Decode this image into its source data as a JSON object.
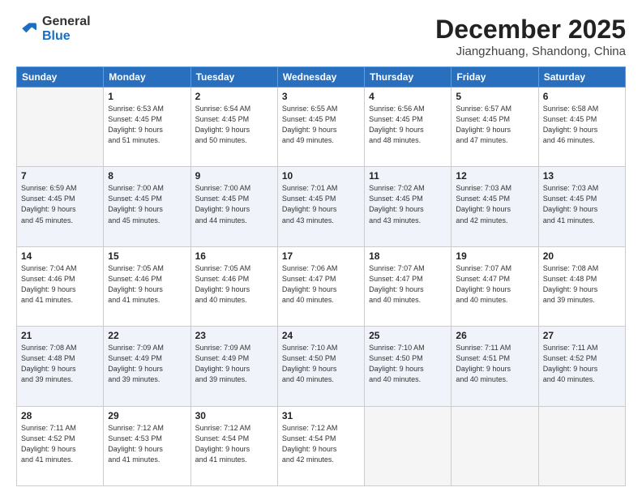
{
  "header": {
    "logo": {
      "general": "General",
      "blue": "Blue"
    },
    "title": "December 2025",
    "location": "Jiangzhuang, Shandong, China"
  },
  "weekdays": [
    "Sunday",
    "Monday",
    "Tuesday",
    "Wednesday",
    "Thursday",
    "Friday",
    "Saturday"
  ],
  "weeks": [
    [
      {
        "day": "",
        "sunrise": "",
        "sunset": "",
        "daylight": ""
      },
      {
        "day": "1",
        "sunrise": "Sunrise: 6:53 AM",
        "sunset": "Sunset: 4:45 PM",
        "daylight": "Daylight: 9 hours and 51 minutes."
      },
      {
        "day": "2",
        "sunrise": "Sunrise: 6:54 AM",
        "sunset": "Sunset: 4:45 PM",
        "daylight": "Daylight: 9 hours and 50 minutes."
      },
      {
        "day": "3",
        "sunrise": "Sunrise: 6:55 AM",
        "sunset": "Sunset: 4:45 PM",
        "daylight": "Daylight: 9 hours and 49 minutes."
      },
      {
        "day": "4",
        "sunrise": "Sunrise: 6:56 AM",
        "sunset": "Sunset: 4:45 PM",
        "daylight": "Daylight: 9 hours and 48 minutes."
      },
      {
        "day": "5",
        "sunrise": "Sunrise: 6:57 AM",
        "sunset": "Sunset: 4:45 PM",
        "daylight": "Daylight: 9 hours and 47 minutes."
      },
      {
        "day": "6",
        "sunrise": "Sunrise: 6:58 AM",
        "sunset": "Sunset: 4:45 PM",
        "daylight": "Daylight: 9 hours and 46 minutes."
      }
    ],
    [
      {
        "day": "7",
        "sunrise": "Sunrise: 6:59 AM",
        "sunset": "Sunset: 4:45 PM",
        "daylight": "Daylight: 9 hours and 45 minutes."
      },
      {
        "day": "8",
        "sunrise": "Sunrise: 7:00 AM",
        "sunset": "Sunset: 4:45 PM",
        "daylight": "Daylight: 9 hours and 45 minutes."
      },
      {
        "day": "9",
        "sunrise": "Sunrise: 7:00 AM",
        "sunset": "Sunset: 4:45 PM",
        "daylight": "Daylight: 9 hours and 44 minutes."
      },
      {
        "day": "10",
        "sunrise": "Sunrise: 7:01 AM",
        "sunset": "Sunset: 4:45 PM",
        "daylight": "Daylight: 9 hours and 43 minutes."
      },
      {
        "day": "11",
        "sunrise": "Sunrise: 7:02 AM",
        "sunset": "Sunset: 4:45 PM",
        "daylight": "Daylight: 9 hours and 43 minutes."
      },
      {
        "day": "12",
        "sunrise": "Sunrise: 7:03 AM",
        "sunset": "Sunset: 4:45 PM",
        "daylight": "Daylight: 9 hours and 42 minutes."
      },
      {
        "day": "13",
        "sunrise": "Sunrise: 7:03 AM",
        "sunset": "Sunset: 4:45 PM",
        "daylight": "Daylight: 9 hours and 41 minutes."
      }
    ],
    [
      {
        "day": "14",
        "sunrise": "Sunrise: 7:04 AM",
        "sunset": "Sunset: 4:46 PM",
        "daylight": "Daylight: 9 hours and 41 minutes."
      },
      {
        "day": "15",
        "sunrise": "Sunrise: 7:05 AM",
        "sunset": "Sunset: 4:46 PM",
        "daylight": "Daylight: 9 hours and 41 minutes."
      },
      {
        "day": "16",
        "sunrise": "Sunrise: 7:05 AM",
        "sunset": "Sunset: 4:46 PM",
        "daylight": "Daylight: 9 hours and 40 minutes."
      },
      {
        "day": "17",
        "sunrise": "Sunrise: 7:06 AM",
        "sunset": "Sunset: 4:47 PM",
        "daylight": "Daylight: 9 hours and 40 minutes."
      },
      {
        "day": "18",
        "sunrise": "Sunrise: 7:07 AM",
        "sunset": "Sunset: 4:47 PM",
        "daylight": "Daylight: 9 hours and 40 minutes."
      },
      {
        "day": "19",
        "sunrise": "Sunrise: 7:07 AM",
        "sunset": "Sunset: 4:47 PM",
        "daylight": "Daylight: 9 hours and 40 minutes."
      },
      {
        "day": "20",
        "sunrise": "Sunrise: 7:08 AM",
        "sunset": "Sunset: 4:48 PM",
        "daylight": "Daylight: 9 hours and 39 minutes."
      }
    ],
    [
      {
        "day": "21",
        "sunrise": "Sunrise: 7:08 AM",
        "sunset": "Sunset: 4:48 PM",
        "daylight": "Daylight: 9 hours and 39 minutes."
      },
      {
        "day": "22",
        "sunrise": "Sunrise: 7:09 AM",
        "sunset": "Sunset: 4:49 PM",
        "daylight": "Daylight: 9 hours and 39 minutes."
      },
      {
        "day": "23",
        "sunrise": "Sunrise: 7:09 AM",
        "sunset": "Sunset: 4:49 PM",
        "daylight": "Daylight: 9 hours and 39 minutes."
      },
      {
        "day": "24",
        "sunrise": "Sunrise: 7:10 AM",
        "sunset": "Sunset: 4:50 PM",
        "daylight": "Daylight: 9 hours and 40 minutes."
      },
      {
        "day": "25",
        "sunrise": "Sunrise: 7:10 AM",
        "sunset": "Sunset: 4:50 PM",
        "daylight": "Daylight: 9 hours and 40 minutes."
      },
      {
        "day": "26",
        "sunrise": "Sunrise: 7:11 AM",
        "sunset": "Sunset: 4:51 PM",
        "daylight": "Daylight: 9 hours and 40 minutes."
      },
      {
        "day": "27",
        "sunrise": "Sunrise: 7:11 AM",
        "sunset": "Sunset: 4:52 PM",
        "daylight": "Daylight: 9 hours and 40 minutes."
      }
    ],
    [
      {
        "day": "28",
        "sunrise": "Sunrise: 7:11 AM",
        "sunset": "Sunset: 4:52 PM",
        "daylight": "Daylight: 9 hours and 41 minutes."
      },
      {
        "day": "29",
        "sunrise": "Sunrise: 7:12 AM",
        "sunset": "Sunset: 4:53 PM",
        "daylight": "Daylight: 9 hours and 41 minutes."
      },
      {
        "day": "30",
        "sunrise": "Sunrise: 7:12 AM",
        "sunset": "Sunset: 4:54 PM",
        "daylight": "Daylight: 9 hours and 41 minutes."
      },
      {
        "day": "31",
        "sunrise": "Sunrise: 7:12 AM",
        "sunset": "Sunset: 4:54 PM",
        "daylight": "Daylight: 9 hours and 42 minutes."
      },
      {
        "day": "",
        "sunrise": "",
        "sunset": "",
        "daylight": ""
      },
      {
        "day": "",
        "sunrise": "",
        "sunset": "",
        "daylight": ""
      },
      {
        "day": "",
        "sunrise": "",
        "sunset": "",
        "daylight": ""
      }
    ]
  ]
}
